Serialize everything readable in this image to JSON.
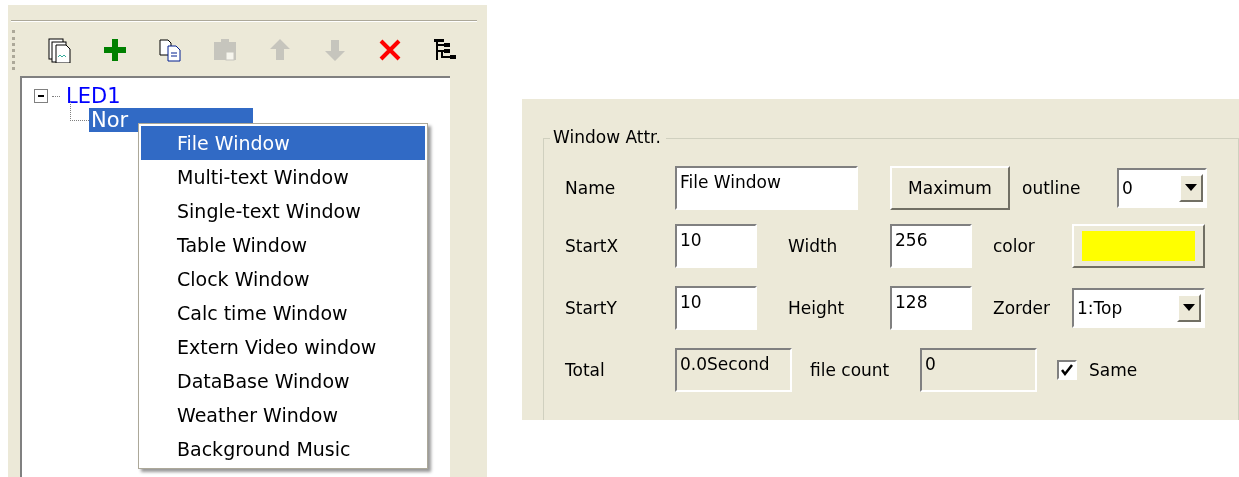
{
  "toolbar": [
    {
      "kind": "pages",
      "disabled": false
    },
    {
      "kind": "add",
      "disabled": false
    },
    {
      "kind": "copy",
      "disabled": false
    },
    {
      "kind": "paste",
      "disabled": true
    },
    {
      "kind": "up",
      "disabled": true
    },
    {
      "kind": "down",
      "disabled": true
    },
    {
      "kind": "delete",
      "disabled": false
    },
    {
      "kind": "tree",
      "disabled": false
    }
  ],
  "tree": [
    {
      "label": "LED1",
      "expanded": true,
      "selected": false,
      "children": [
        {
          "label": "Nor",
          "selected": true
        }
      ]
    }
  ],
  "context_menu": [
    {
      "label": "File Window",
      "selected": true
    },
    {
      "label": "Multi-text Window",
      "selected": false
    },
    {
      "label": "Single-text Window",
      "selected": false
    },
    {
      "label": "Table Window",
      "selected": false
    },
    {
      "label": "Clock Window",
      "selected": false
    },
    {
      "label": "Calc time Window",
      "selected": false
    },
    {
      "label": "Extern Video window",
      "selected": false
    },
    {
      "label": "DataBase Window",
      "selected": false
    },
    {
      "label": "Weather Window",
      "selected": false
    },
    {
      "label": "Background Music",
      "selected": false
    }
  ],
  "window_attr": {
    "title": "Window Attr.",
    "name": {
      "label": "Name",
      "value": "File Window"
    },
    "maximum_button": "Maximum",
    "outline": {
      "label": "outline",
      "value": "0"
    },
    "start_x": {
      "label": "StartX",
      "value": "10"
    },
    "width": {
      "label": "Width",
      "value": "256"
    },
    "color": {
      "label": "color",
      "color": "#ffff00"
    },
    "start_y": {
      "label": "StartY",
      "value": "10"
    },
    "height": {
      "label": "Height",
      "value": "128"
    },
    "zorder": {
      "label": "Zorder",
      "value": "1:Top"
    },
    "total": {
      "label": "Total",
      "value": "0.0Second"
    },
    "file_count": {
      "label": "file count",
      "value": "0"
    },
    "same": {
      "label": "Same",
      "checked": true
    }
  }
}
